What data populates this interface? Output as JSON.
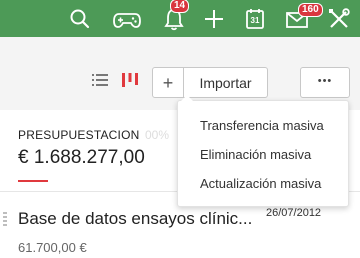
{
  "topbar": {
    "icons": [
      "search-icon",
      "gamepad-icon",
      "bell-icon",
      "plus-icon",
      "calendar-icon",
      "mail-icon",
      "tools-icon"
    ],
    "notifications_count": "14",
    "messages_count": "160",
    "calendar_day": "31"
  },
  "toolbar": {
    "add_symbol": "+",
    "import_label": "Importar",
    "more_symbol": "•••"
  },
  "summary": {
    "label": "PRESUPUESTACION",
    "amount": "€ 1.688.277,00",
    "hidden_fragment": "00%"
  },
  "menu": {
    "items": [
      {
        "label": "Transferencia masiva"
      },
      {
        "label": "Eliminación masiva"
      },
      {
        "label": "Actualización masiva"
      }
    ]
  },
  "list": {
    "items": [
      {
        "title": "Base de datos ensayos clínic...",
        "date": "26/07/2012",
        "amount": "61.700,00 €"
      }
    ]
  },
  "colors": {
    "topbar": "#4d9a57",
    "badge": "#d9363e",
    "accent_red": "#e0393e"
  }
}
